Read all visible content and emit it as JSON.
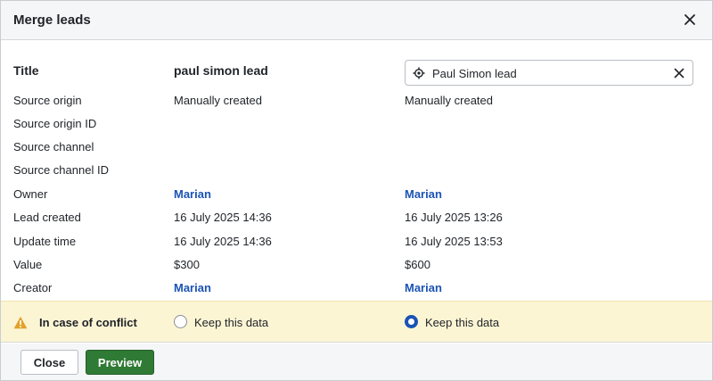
{
  "dialog": {
    "title": "Merge leads"
  },
  "fields": [
    {
      "label": "Title",
      "lead1": "paul simon lead",
      "lead2": "Paul Simon lead"
    },
    {
      "label": "Source origin",
      "lead1": "Manually created",
      "lead2": "Manually created"
    },
    {
      "label": "Source origin ID",
      "lead1": "",
      "lead2": ""
    },
    {
      "label": "Source channel",
      "lead1": "",
      "lead2": ""
    },
    {
      "label": "Source channel ID",
      "lead1": "",
      "lead2": ""
    },
    {
      "label": "Owner",
      "lead1": "Marian",
      "lead2": "Marian"
    },
    {
      "label": "Lead created",
      "lead1": "16 July 2025 14:36",
      "lead2": "16 July 2025 13:26"
    },
    {
      "label": "Update time",
      "lead1": "16 July 2025 14:36",
      "lead2": "16 July 2025 13:53"
    },
    {
      "label": "Value",
      "lead1": "$300",
      "lead2": "$600"
    },
    {
      "label": "Creator",
      "lead1": "Marian",
      "lead2": "Marian"
    }
  ],
  "conflict": {
    "label": "In case of conflict",
    "option1": {
      "label": "Keep this data",
      "selected": false
    },
    "option2": {
      "label": "Keep this data",
      "selected": true
    }
  },
  "footer": {
    "close_label": "Close",
    "preview_label": "Preview"
  },
  "icons": {
    "close": "close-icon",
    "target": "target-icon",
    "clear": "clear-icon",
    "warning": "warning-icon"
  },
  "colors": {
    "link": "#1b53b5",
    "primary_button": "#2f7a35",
    "conflict_background": "#fcf5d4",
    "warning": "#e2a12a"
  }
}
